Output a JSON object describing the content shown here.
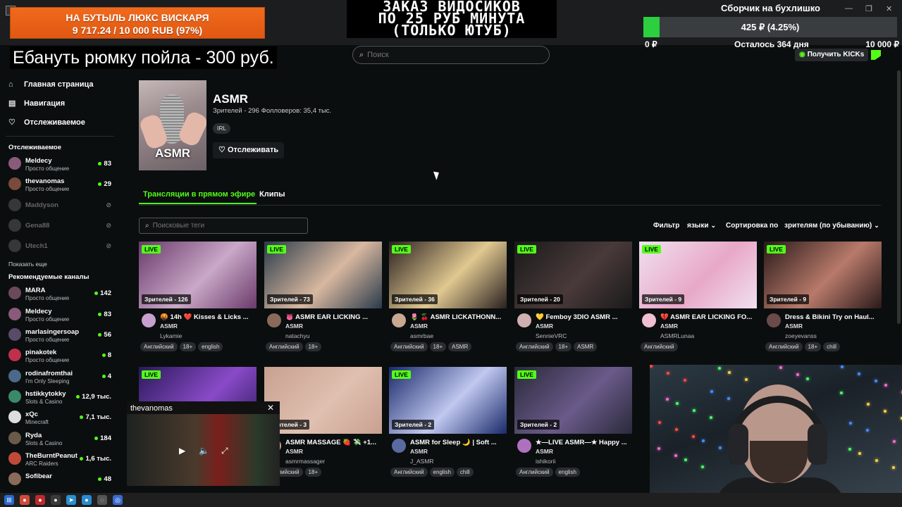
{
  "overlay": {
    "left_goal": {
      "line1": "НА БУТЫЛЬ ЛЮКС ВИСКАРЯ",
      "line2": "9 717.24 / 10 000 RUB (97%)"
    },
    "center_title": {
      "line1": "ЗАКАЗ ВИДОСИКОВ",
      "line2": "ПО 25 РУБ МИНУТА",
      "line3": "(ТОЛЬКО ЮТУБ)"
    },
    "right_goal": {
      "title": "Сборчик на бухлишко",
      "progress_text": "425 ₽ (4.25%)",
      "progress_fraction": 0.0425,
      "min": "0 ₽",
      "remaining": "Осталось 364 дня",
      "max": "10 000 ₽"
    },
    "banner": "Ебануть рюмку пойла - 300 руб."
  },
  "header": {
    "search_placeholder": "Поиск",
    "kicks_button": "Получить KICKs"
  },
  "sidebar": {
    "nav": [
      {
        "label": "Главная страница",
        "icon": "home-icon"
      },
      {
        "label": "Навигация",
        "icon": "browse-icon"
      },
      {
        "label": "Отслеживаемое",
        "icon": "heart-icon"
      }
    ],
    "following_title": "Отслеживаемое",
    "following": [
      {
        "name": "Meldecy",
        "category": "Просто общение",
        "count": "83",
        "color": "#8a5a7a"
      },
      {
        "name": "thevanomas",
        "category": "Просто общение",
        "count": "29",
        "color": "#7a4a3a"
      },
      {
        "name": "Maddyson",
        "category": "",
        "count": "",
        "color": "#888888"
      },
      {
        "name": "Gena88",
        "category": "",
        "count": "",
        "color": "#888888"
      },
      {
        "name": "Utech1",
        "category": "",
        "count": "",
        "color": "#888888"
      }
    ],
    "show_more": "Показать еще",
    "recommended_title": "Рекомендуемые каналы",
    "recommended": [
      {
        "name": "MARA",
        "category": "Просто общение",
        "count": "142",
        "color": "#6a4a5a"
      },
      {
        "name": "Meldecy",
        "category": "Просто общение",
        "count": "83",
        "color": "#8a5a7a"
      },
      {
        "name": "marlasingersoap",
        "category": "Просто общение",
        "count": "56",
        "color": "#5a4a6a"
      },
      {
        "name": "pinakotek",
        "category": "Просто общение",
        "count": "8",
        "color": "#c0304a"
      },
      {
        "name": "rodinafromthai",
        "category": "I'm Only Sleeping",
        "count": "4",
        "color": "#4a6a8a"
      },
      {
        "name": "hstikkytokky",
        "category": "Slots & Casino",
        "count": "12,9 тыс.",
        "color": "#3a8a6a"
      },
      {
        "name": "xQc",
        "category": "Minecraft",
        "count": "7,1 тыс.",
        "color": "#dddddd"
      },
      {
        "name": "Ryda",
        "category": "Slots & Casino",
        "count": "184",
        "color": "#6a5a4a"
      },
      {
        "name": "TheBurntPeanut",
        "category": "ARC Raiders",
        "count": "1,6 тыс.",
        "color": "#c04a3a"
      },
      {
        "name": "Sofibear",
        "category": "",
        "count": "48",
        "color": "#8a6a5a"
      }
    ]
  },
  "category": {
    "thumb_label": "ASMR",
    "title": "ASMR",
    "stats": "Зрителей - 296   Фолловеров: 35,4 тыс.",
    "tag": "IRL",
    "follow_button": "Отслеживать"
  },
  "tabs": [
    {
      "label": "Трансляции в прямом эфире"
    },
    {
      "label": "Клипы"
    }
  ],
  "filters": {
    "tag_search_placeholder": "Поисковые теги",
    "filter_label": "Фильтр",
    "languages": "языки",
    "sort_label": "Сортировка по",
    "sort_value": "зрителям (по убыванию)"
  },
  "streams": [
    {
      "live": "LIVE",
      "viewers": "Зрителей - 126",
      "title": "🤬 14h ❤️ Kisses & Licks ...",
      "category": "ASMR",
      "user": "Lykamie",
      "tags": [
        "Английский",
        "18+",
        "english"
      ],
      "bg": "#6a3a6a",
      "bg2": "#c9a8c8",
      "avatar": "#c8a0d0"
    },
    {
      "live": "LIVE",
      "viewers": "Зрителей - 73",
      "title": "👅 ASMR EAR LICKING ...",
      "category": "ASMR",
      "user": "natachyu",
      "tags": [
        "Английский",
        "18+"
      ],
      "bg": "#2a3a4a",
      "bg2": "#d8b8a0",
      "avatar": "#8a6a5a"
    },
    {
      "live": "LIVE",
      "viewers": "Зрителей - 36",
      "title": "🌷 🍒 ASMR LICKATHONN...",
      "category": "ASMR",
      "user": "asmrbae",
      "tags": [
        "Английский",
        "18+",
        "ASMR"
      ],
      "bg": "#2a2020",
      "bg2": "#e0c890",
      "avatar": "#c8a890"
    },
    {
      "live": "LIVE",
      "viewers": "Зрителей - 20",
      "title": "💛 Femboy 3DIO ASMR ...",
      "category": "ASMR",
      "user": "SennieVRC",
      "tags": [
        "Английский",
        "18+",
        "ASMR"
      ],
      "bg": "#1a1a1a",
      "bg2": "#4a3a3a",
      "avatar": "#d0b0b0"
    },
    {
      "live": "LIVE",
      "viewers": "Зрителей - 9",
      "title": "💔 ASMR EAR LICKING FO...",
      "category": "ASMR",
      "user": "ASMRLunaa",
      "tags": [
        "Английский"
      ],
      "bg": "#f0e0f0",
      "bg2": "#e8a8c8",
      "avatar": "#f0c0d0"
    },
    {
      "live": "LIVE",
      "viewers": "Зрителей - 9",
      "title": "Dress & Bikini Try on Haul...",
      "category": "ASMR",
      "user": "zoeyevanss",
      "tags": [
        "Английский",
        "18+",
        "chill"
      ],
      "bg": "#2a1a1a",
      "bg2": "#b87a6a",
      "avatar": "#6a4a4a"
    },
    {
      "live": "LIVE",
      "viewers": "",
      "title": "",
      "category": "",
      "user": "",
      "tags": [],
      "bg": "#2a1a5a",
      "bg2": "#8a4ac8",
      "avatar": "#5a4a8a"
    },
    {
      "live": "",
      "viewers": "Зрителей - 3",
      "title": "ASMR MASSAGE 🍓 💸 +1...",
      "category": "ASMR",
      "user": "asmrmassager",
      "tags": [
        "Английский",
        "18+"
      ],
      "bg": "#c8a090",
      "bg2": "#e0c0b0",
      "avatar": "#c8a090"
    },
    {
      "live": "LIVE",
      "viewers": "Зрителей - 2",
      "title": "ASMR for Sleep 🌙 | Soft ...",
      "category": "ASMR",
      "user": "J_ASMR",
      "tags": [
        "Английский",
        "english",
        "chill"
      ],
      "bg": "#1a2a6a",
      "bg2": "#c0c8f0",
      "avatar": "#5a6aa0"
    },
    {
      "live": "LIVE",
      "viewers": "Зрителей - 2",
      "title": "★—LIVE ASMR—★ Happy ...",
      "category": "ASMR",
      "user": "ishikorii",
      "tags": [
        "Английский",
        "english"
      ],
      "bg": "#2a2a3a",
      "bg2": "#6a5a8a",
      "avatar": "#b070c0"
    }
  ],
  "popup": {
    "title": "thevanomas"
  }
}
